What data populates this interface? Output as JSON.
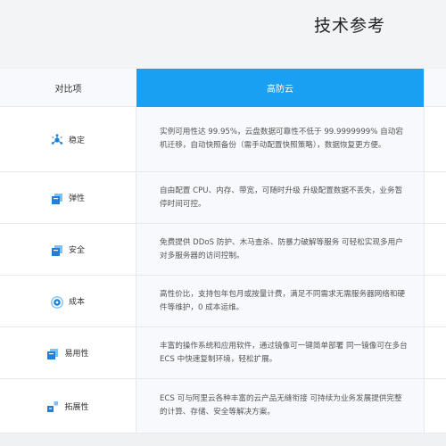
{
  "page": {
    "title": "技术参考"
  },
  "table": {
    "header": {
      "label_col": "对比项",
      "product_col": "高防云"
    },
    "rows": [
      {
        "label": "稳定",
        "icon": "gear-network-icon",
        "desc": "实例可用性达 99.95%，云盘数据可靠性不低于 99.9999999% 自动宕机迁移，自动快照备份（需手动配置快照策略），数据恢复更方便。"
      },
      {
        "label": "弹性",
        "icon": "window-stack-icon",
        "desc": "自由配置 CPU、内存、带宽，可随时升级 升级配置数据不丢失，业务暂停时间可控。"
      },
      {
        "label": "安全",
        "icon": "window-stack-icon",
        "desc": "免费提供 DDoS 防护、木马查杀、防暴力破解等服务 可轻松实现多用户对多服务器的访问控制。"
      },
      {
        "label": "成本",
        "icon": "circle-target-icon",
        "desc": "高性价比，支持包年包月或按量计费，满足不同需求无需服务器网络和硬件等维护，0 成本运维。"
      },
      {
        "label": "易用性",
        "icon": "window-stack-icon",
        "desc": "丰富的操作系统和应用软件，通过镜像可一键简单部署 同一镜像可在多台 ECS 中快速复制环境，轻松扩展。"
      },
      {
        "label": "拓展性",
        "icon": "expand-blocks-icon",
        "desc": "ECS 可与阿里云各种丰富的云产品无缝衔接 可持续为业务发展提供完整的计算、存储、安全等解决方案。"
      }
    ]
  },
  "colors": {
    "accent": "#1aa0f3",
    "icon_blue": "#1f7fd9"
  }
}
